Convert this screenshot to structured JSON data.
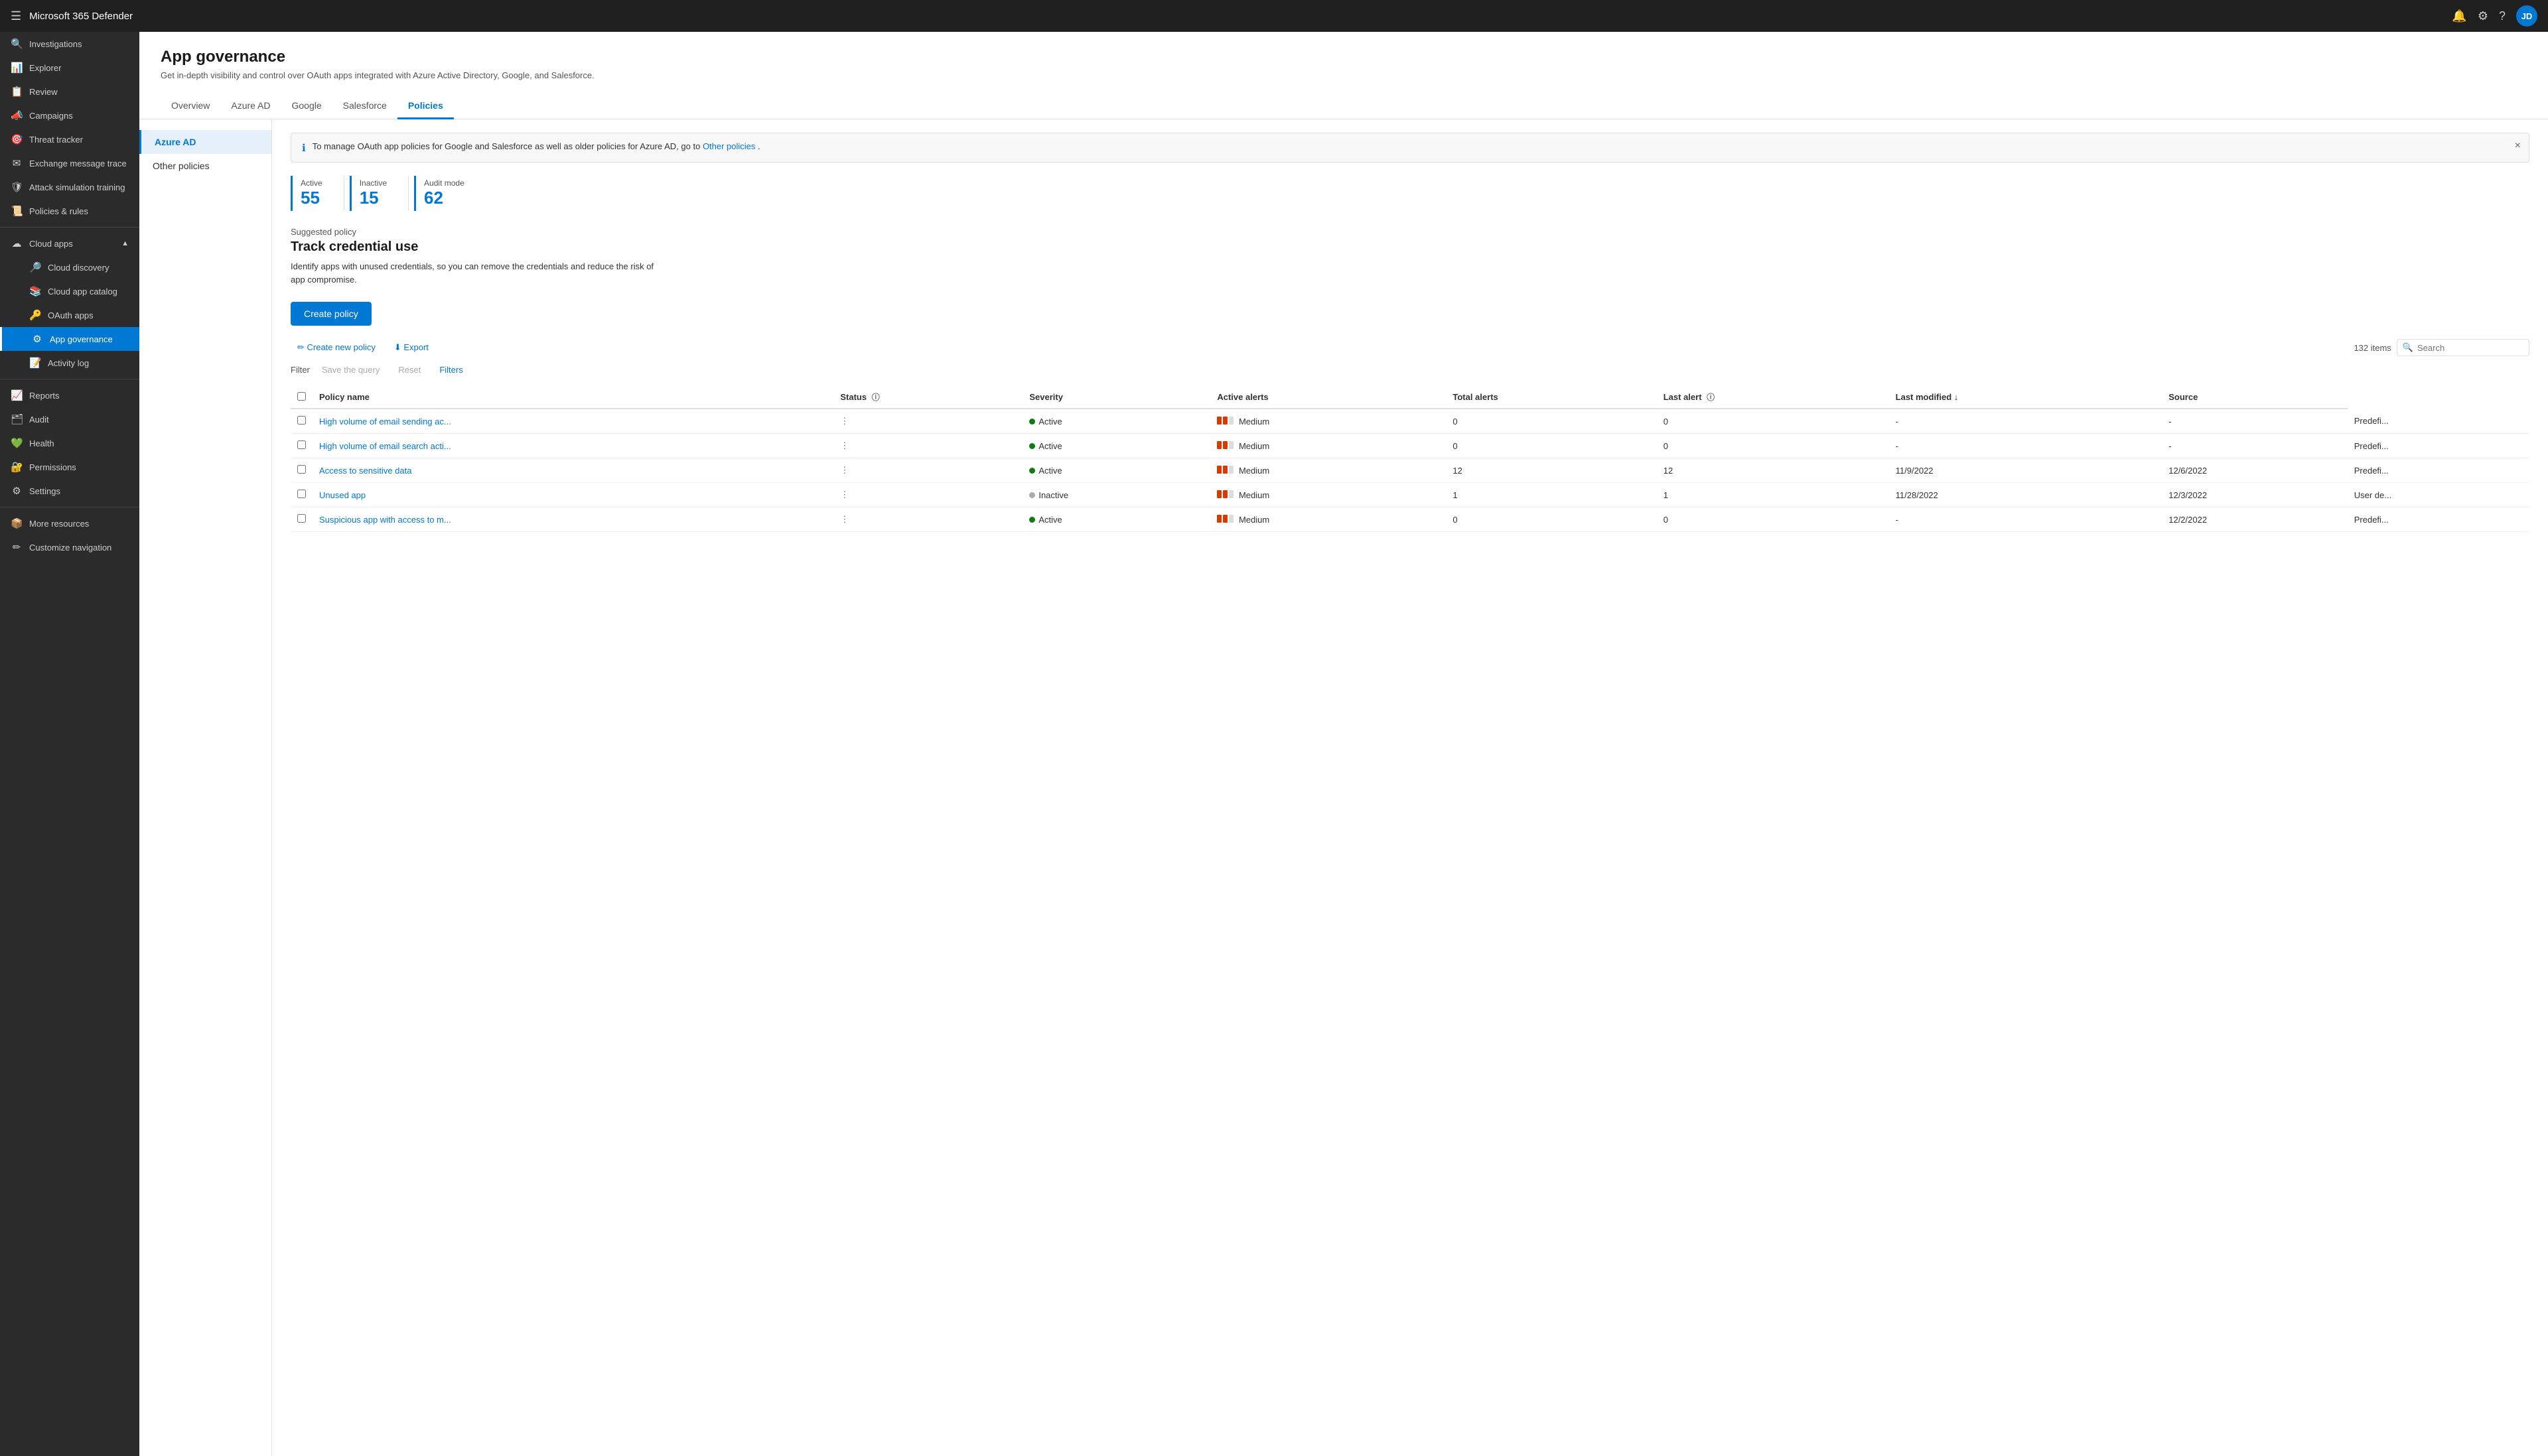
{
  "topbar": {
    "title": "Microsoft 365 Defender",
    "avatar_initials": "JD"
  },
  "sidebar": {
    "items": [
      {
        "id": "investigations",
        "label": "Investigations",
        "icon": "🔍",
        "level": 0
      },
      {
        "id": "explorer",
        "label": "Explorer",
        "icon": "📊",
        "level": 0
      },
      {
        "id": "review",
        "label": "Review",
        "icon": "📋",
        "level": 0
      },
      {
        "id": "campaigns",
        "label": "Campaigns",
        "icon": "📣",
        "level": 0
      },
      {
        "id": "threat-tracker",
        "label": "Threat tracker",
        "icon": "🎯",
        "level": 0
      },
      {
        "id": "exchange-message-trace",
        "label": "Exchange message trace",
        "icon": "✉️",
        "level": 0
      },
      {
        "id": "attack-simulation",
        "label": "Attack simulation training",
        "icon": "🛡️",
        "level": 0
      },
      {
        "id": "policies-rules",
        "label": "Policies & rules",
        "icon": "📜",
        "level": 0
      },
      {
        "id": "cloud-apps",
        "label": "Cloud apps",
        "icon": "☁️",
        "level": 0,
        "expanded": true
      },
      {
        "id": "cloud-discovery",
        "label": "Cloud discovery",
        "icon": "🔎",
        "level": 1
      },
      {
        "id": "cloud-app-catalog",
        "label": "Cloud app catalog",
        "icon": "📚",
        "level": 1
      },
      {
        "id": "oauth-apps",
        "label": "OAuth apps",
        "icon": "🔑",
        "level": 1
      },
      {
        "id": "app-governance",
        "label": "App governance",
        "icon": "⚙️",
        "level": 1,
        "active": true
      },
      {
        "id": "activity-log",
        "label": "Activity log",
        "icon": "📝",
        "level": 1
      },
      {
        "id": "reports",
        "label": "Reports",
        "icon": "📈",
        "level": 0
      },
      {
        "id": "audit",
        "label": "Audit",
        "icon": "🗂️",
        "level": 0
      },
      {
        "id": "health",
        "label": "Health",
        "icon": "💚",
        "level": 0
      },
      {
        "id": "permissions",
        "label": "Permissions",
        "icon": "🔐",
        "level": 0
      },
      {
        "id": "settings",
        "label": "Settings",
        "icon": "⚙️",
        "level": 0
      },
      {
        "id": "more-resources",
        "label": "More resources",
        "icon": "📦",
        "level": 0
      },
      {
        "id": "customize-nav",
        "label": "Customize navigation",
        "icon": "✏️",
        "level": 0
      }
    ]
  },
  "page": {
    "title": "App governance",
    "subtitle": "Get in-depth visibility and control over OAuth apps integrated with Azure Active Directory, Google, and Salesforce.",
    "tabs": [
      {
        "id": "overview",
        "label": "Overview",
        "active": false
      },
      {
        "id": "azure-ad",
        "label": "Azure AD",
        "active": false
      },
      {
        "id": "google",
        "label": "Google",
        "active": false
      },
      {
        "id": "salesforce",
        "label": "Salesforce",
        "active": false
      },
      {
        "id": "policies",
        "label": "Policies",
        "active": true
      }
    ]
  },
  "left_nav": [
    {
      "id": "azure-ad",
      "label": "Azure AD",
      "active": true
    },
    {
      "id": "other-policies",
      "label": "Other policies",
      "active": false
    }
  ],
  "info_banner": {
    "text": "To manage OAuth app policies for Google and Salesforce as well as older policies for Azure AD, go to",
    "link_text": "Other policies",
    "text_after": "."
  },
  "stats": [
    {
      "id": "active",
      "label": "Active",
      "value": "55"
    },
    {
      "id": "inactive",
      "label": "Inactive",
      "value": "15"
    },
    {
      "id": "audit-mode",
      "label": "Audit mode",
      "value": "62"
    }
  ],
  "suggested_policy": {
    "label": "Suggested policy",
    "title": "Track credential use",
    "description": "Identify apps with unused credentials, so you can remove the credentials and reduce the risk of app compromise."
  },
  "toolbar": {
    "create_policy_btn": "Create policy",
    "create_new_policy_btn": "✏ Create new policy",
    "export_btn": "⬇ Export",
    "filter_label": "Filter",
    "save_query_btn": "Save the query",
    "reset_btn": "Reset",
    "filters_btn": "Filters",
    "items_count": "132 items",
    "search_placeholder": "Search"
  },
  "table": {
    "columns": [
      {
        "id": "name",
        "label": "Policy name"
      },
      {
        "id": "status",
        "label": "Status"
      },
      {
        "id": "severity",
        "label": "Severity"
      },
      {
        "id": "active-alerts",
        "label": "Active alerts"
      },
      {
        "id": "total-alerts",
        "label": "Total alerts"
      },
      {
        "id": "last-alert",
        "label": "Last alert"
      },
      {
        "id": "last-modified",
        "label": "Last modified ↓"
      },
      {
        "id": "source",
        "label": "Source"
      }
    ],
    "rows": [
      {
        "name": "High volume of email sending ac...",
        "status": "Active",
        "status_type": "active",
        "severity": "Medium",
        "active_alerts": "0",
        "total_alerts": "0",
        "last_alert": "-",
        "last_modified": "-",
        "source": "Predefi..."
      },
      {
        "name": "High volume of email search acti...",
        "status": "Active",
        "status_type": "active",
        "severity": "Medium",
        "active_alerts": "0",
        "total_alerts": "0",
        "last_alert": "-",
        "last_modified": "-",
        "source": "Predefi..."
      },
      {
        "name": "Access to sensitive data",
        "status": "Active",
        "status_type": "active",
        "severity": "Medium",
        "active_alerts": "12",
        "total_alerts": "12",
        "last_alert": "11/9/2022",
        "last_modified": "12/6/2022",
        "source": "Predefi..."
      },
      {
        "name": "Unused app",
        "status": "Inactive",
        "status_type": "inactive",
        "severity": "Medium",
        "active_alerts": "1",
        "total_alerts": "1",
        "last_alert": "11/28/2022",
        "last_modified": "12/3/2022",
        "source": "User de..."
      },
      {
        "name": "Suspicious app with access to m...",
        "status": "Active",
        "status_type": "active",
        "severity": "Medium",
        "active_alerts": "0",
        "total_alerts": "0",
        "last_alert": "-",
        "last_modified": "12/2/2022",
        "source": "Predefi..."
      }
    ]
  }
}
